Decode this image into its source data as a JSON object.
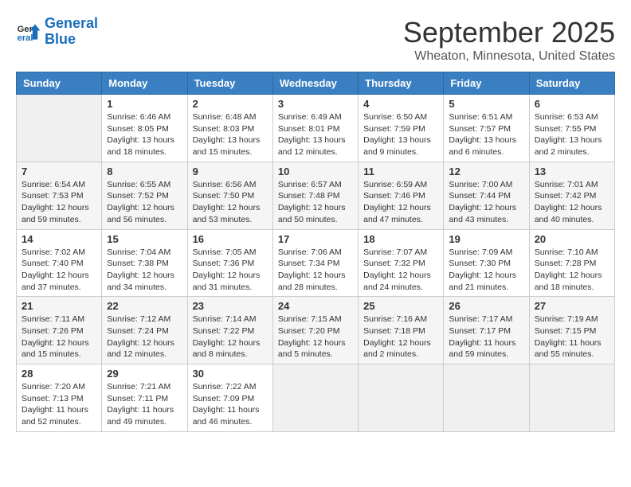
{
  "logo": {
    "line1": "General",
    "line2": "Blue"
  },
  "title": "September 2025",
  "location": "Wheaton, Minnesota, United States",
  "days_of_week": [
    "Sunday",
    "Monday",
    "Tuesday",
    "Wednesday",
    "Thursday",
    "Friday",
    "Saturday"
  ],
  "weeks": [
    [
      {
        "day": "",
        "info": ""
      },
      {
        "day": "1",
        "info": "Sunrise: 6:46 AM\nSunset: 8:05 PM\nDaylight: 13 hours\nand 18 minutes."
      },
      {
        "day": "2",
        "info": "Sunrise: 6:48 AM\nSunset: 8:03 PM\nDaylight: 13 hours\nand 15 minutes."
      },
      {
        "day": "3",
        "info": "Sunrise: 6:49 AM\nSunset: 8:01 PM\nDaylight: 13 hours\nand 12 minutes."
      },
      {
        "day": "4",
        "info": "Sunrise: 6:50 AM\nSunset: 7:59 PM\nDaylight: 13 hours\nand 9 minutes."
      },
      {
        "day": "5",
        "info": "Sunrise: 6:51 AM\nSunset: 7:57 PM\nDaylight: 13 hours\nand 6 minutes."
      },
      {
        "day": "6",
        "info": "Sunrise: 6:53 AM\nSunset: 7:55 PM\nDaylight: 13 hours\nand 2 minutes."
      }
    ],
    [
      {
        "day": "7",
        "info": "Sunrise: 6:54 AM\nSunset: 7:53 PM\nDaylight: 12 hours\nand 59 minutes."
      },
      {
        "day": "8",
        "info": "Sunrise: 6:55 AM\nSunset: 7:52 PM\nDaylight: 12 hours\nand 56 minutes."
      },
      {
        "day": "9",
        "info": "Sunrise: 6:56 AM\nSunset: 7:50 PM\nDaylight: 12 hours\nand 53 minutes."
      },
      {
        "day": "10",
        "info": "Sunrise: 6:57 AM\nSunset: 7:48 PM\nDaylight: 12 hours\nand 50 minutes."
      },
      {
        "day": "11",
        "info": "Sunrise: 6:59 AM\nSunset: 7:46 PM\nDaylight: 12 hours\nand 47 minutes."
      },
      {
        "day": "12",
        "info": "Sunrise: 7:00 AM\nSunset: 7:44 PM\nDaylight: 12 hours\nand 43 minutes."
      },
      {
        "day": "13",
        "info": "Sunrise: 7:01 AM\nSunset: 7:42 PM\nDaylight: 12 hours\nand 40 minutes."
      }
    ],
    [
      {
        "day": "14",
        "info": "Sunrise: 7:02 AM\nSunset: 7:40 PM\nDaylight: 12 hours\nand 37 minutes."
      },
      {
        "day": "15",
        "info": "Sunrise: 7:04 AM\nSunset: 7:38 PM\nDaylight: 12 hours\nand 34 minutes."
      },
      {
        "day": "16",
        "info": "Sunrise: 7:05 AM\nSunset: 7:36 PM\nDaylight: 12 hours\nand 31 minutes."
      },
      {
        "day": "17",
        "info": "Sunrise: 7:06 AM\nSunset: 7:34 PM\nDaylight: 12 hours\nand 28 minutes."
      },
      {
        "day": "18",
        "info": "Sunrise: 7:07 AM\nSunset: 7:32 PM\nDaylight: 12 hours\nand 24 minutes."
      },
      {
        "day": "19",
        "info": "Sunrise: 7:09 AM\nSunset: 7:30 PM\nDaylight: 12 hours\nand 21 minutes."
      },
      {
        "day": "20",
        "info": "Sunrise: 7:10 AM\nSunset: 7:28 PM\nDaylight: 12 hours\nand 18 minutes."
      }
    ],
    [
      {
        "day": "21",
        "info": "Sunrise: 7:11 AM\nSunset: 7:26 PM\nDaylight: 12 hours\nand 15 minutes."
      },
      {
        "day": "22",
        "info": "Sunrise: 7:12 AM\nSunset: 7:24 PM\nDaylight: 12 hours\nand 12 minutes."
      },
      {
        "day": "23",
        "info": "Sunrise: 7:14 AM\nSunset: 7:22 PM\nDaylight: 12 hours\nand 8 minutes."
      },
      {
        "day": "24",
        "info": "Sunrise: 7:15 AM\nSunset: 7:20 PM\nDaylight: 12 hours\nand 5 minutes."
      },
      {
        "day": "25",
        "info": "Sunrise: 7:16 AM\nSunset: 7:18 PM\nDaylight: 12 hours\nand 2 minutes."
      },
      {
        "day": "26",
        "info": "Sunrise: 7:17 AM\nSunset: 7:17 PM\nDaylight: 11 hours\nand 59 minutes."
      },
      {
        "day": "27",
        "info": "Sunrise: 7:19 AM\nSunset: 7:15 PM\nDaylight: 11 hours\nand 55 minutes."
      }
    ],
    [
      {
        "day": "28",
        "info": "Sunrise: 7:20 AM\nSunset: 7:13 PM\nDaylight: 11 hours\nand 52 minutes."
      },
      {
        "day": "29",
        "info": "Sunrise: 7:21 AM\nSunset: 7:11 PM\nDaylight: 11 hours\nand 49 minutes."
      },
      {
        "day": "30",
        "info": "Sunrise: 7:22 AM\nSunset: 7:09 PM\nDaylight: 11 hours\nand 46 minutes."
      },
      {
        "day": "",
        "info": ""
      },
      {
        "day": "",
        "info": ""
      },
      {
        "day": "",
        "info": ""
      },
      {
        "day": "",
        "info": ""
      }
    ]
  ]
}
